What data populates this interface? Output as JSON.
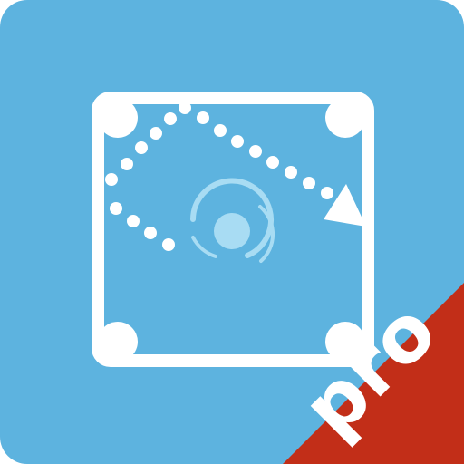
{
  "app_icon": {
    "badge": {
      "label": "pro"
    },
    "icons": {
      "frame": "rounded-square-frame-icon",
      "trajectory": "dotted-trajectory-icon",
      "arrow": "arrowhead-icon",
      "ball": "ball-icon"
    },
    "colors": {
      "background": "#5db3df",
      "foreground": "#ffffff",
      "ball_fill": "#a8dcf3",
      "ring": "#a8dcf3",
      "badge": "#c22e18"
    }
  }
}
